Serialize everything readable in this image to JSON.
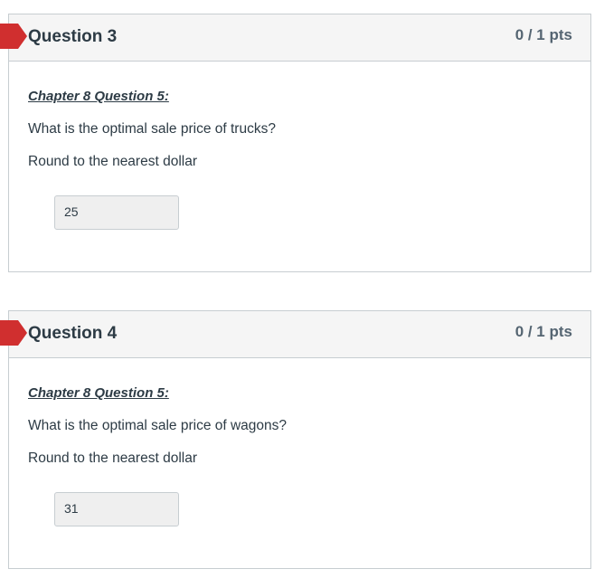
{
  "questions": [
    {
      "title": "Question 3",
      "points": "0 / 1 pts",
      "chapter": "Chapter 8 Question 5:",
      "prompt": "What is the optimal sale price of trucks?",
      "rounding": "Round to the nearest dollar",
      "answer": "25",
      "flag_color": "#d02f2f"
    },
    {
      "title": "Question 4",
      "points": "0 / 1 pts",
      "chapter": "Chapter 8 Question 5:",
      "prompt": "What is the optimal sale price of wagons?",
      "rounding": "Round to the nearest dollar",
      "answer": "31",
      "flag_color": "#d02f2f"
    }
  ]
}
